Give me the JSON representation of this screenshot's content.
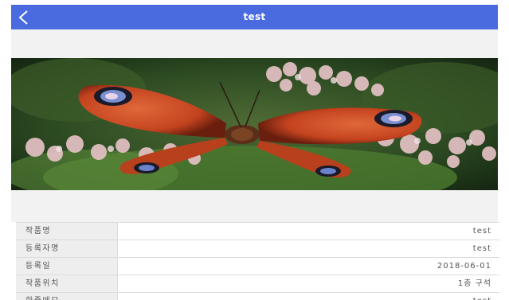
{
  "header": {
    "title": "test",
    "back_icon": "chevron-left-icon",
    "bar_color": "#4a6ae0"
  },
  "image": {
    "subject": "peacock-butterfly-photo"
  },
  "details": [
    {
      "label": "작품명",
      "value": "test"
    },
    {
      "label": "등록자명",
      "value": "test"
    },
    {
      "label": "등록일",
      "value": "2018-06-01"
    },
    {
      "label": "작품위치",
      "value": "1층 구석"
    },
    {
      "label": "한줄메모",
      "value": "test"
    }
  ]
}
